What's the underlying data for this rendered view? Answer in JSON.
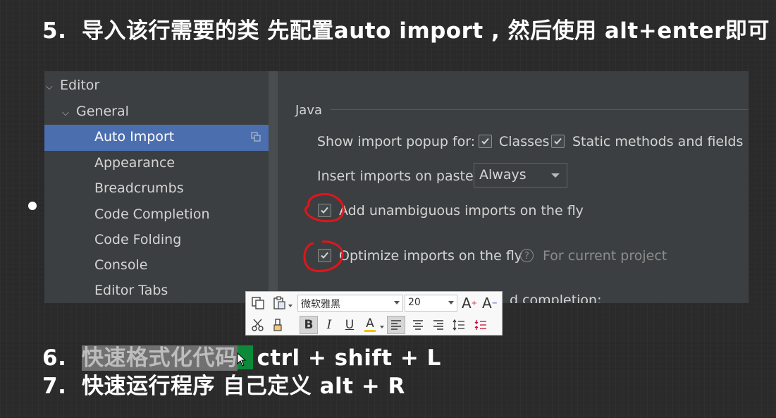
{
  "slide": {
    "step5": {
      "num": "5.",
      "text": "导入该行需要的类 先配置auto import , 然后使用 alt+enter即可"
    },
    "step6": {
      "num": "6.",
      "highlighted": "快速格式化代码",
      "shortcut": "ctrl + shift + L"
    },
    "step7": {
      "num": "7.",
      "text": "快速运行程序 自己定义 alt + R"
    }
  },
  "ide": {
    "tree": {
      "editor": "Editor",
      "general": "General",
      "items": [
        "Auto Import",
        "Appearance",
        "Breadcrumbs",
        "Code Completion",
        "Code Folding",
        "Console",
        "Editor Tabs"
      ]
    },
    "section": "Java",
    "popup_label": "Show import popup for:",
    "classes": "Classes",
    "static_methods": "Static methods and fields",
    "paste_label": "Insert imports on paste:",
    "paste_value": "Always",
    "add_unambiguous": "Add unambiguous imports on the fly",
    "optimize": "Optimize imports on the fly",
    "help_glyph": "?",
    "for_current_project": "For current project",
    "partial_text": "d completion:",
    "annotation_color": "#e0161b",
    "selection_color": "#4b6eaf"
  },
  "toolbar": {
    "font": "微软雅黑",
    "size": "20",
    "bold": "B",
    "italic": "I",
    "underline": "U",
    "font_color_glyph": "A",
    "grow_font_glyph": "A",
    "shrink_font_glyph": "A"
  }
}
